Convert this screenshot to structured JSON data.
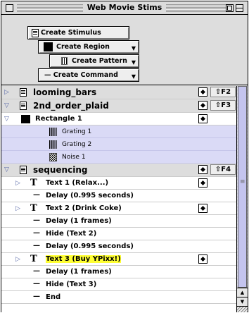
{
  "window": {
    "title": "Web Movie Stims"
  },
  "toolbar": {
    "create_stimulus": "Create Stimulus",
    "create_region": "Create Region",
    "create_pattern": "Create Pattern",
    "create_command": "— Create Command"
  },
  "rows": [
    {
      "label": "looming_bars",
      "shortcut": "⇧F2"
    },
    {
      "label": "2nd_order_plaid",
      "shortcut": "⇧F3"
    },
    {
      "label": "Rectangle 1"
    },
    {
      "label": "Grating 1"
    },
    {
      "label": "Grating 2"
    },
    {
      "label": "Noise 1"
    },
    {
      "label": "sequencing",
      "shortcut": "⇧F4"
    },
    {
      "label": "Text 1 (Relax...)"
    },
    {
      "label": "Delay (0.995 seconds)"
    },
    {
      "label": "Text 2 (Drink Coke)"
    },
    {
      "label": "Delay (1 frames)"
    },
    {
      "label": "Hide (Text 2)"
    },
    {
      "label": "Delay (0.995 seconds)"
    },
    {
      "label": "Text 3 (Buy YPixx!)"
    },
    {
      "label": "Delay (1 frames)"
    },
    {
      "label": "Hide (Text 3)"
    },
    {
      "label": "End"
    }
  ],
  "colors": {
    "selection": "#dadaf6",
    "highlight": "#ffff33",
    "scroll_thumb": "#c4c4ee"
  }
}
